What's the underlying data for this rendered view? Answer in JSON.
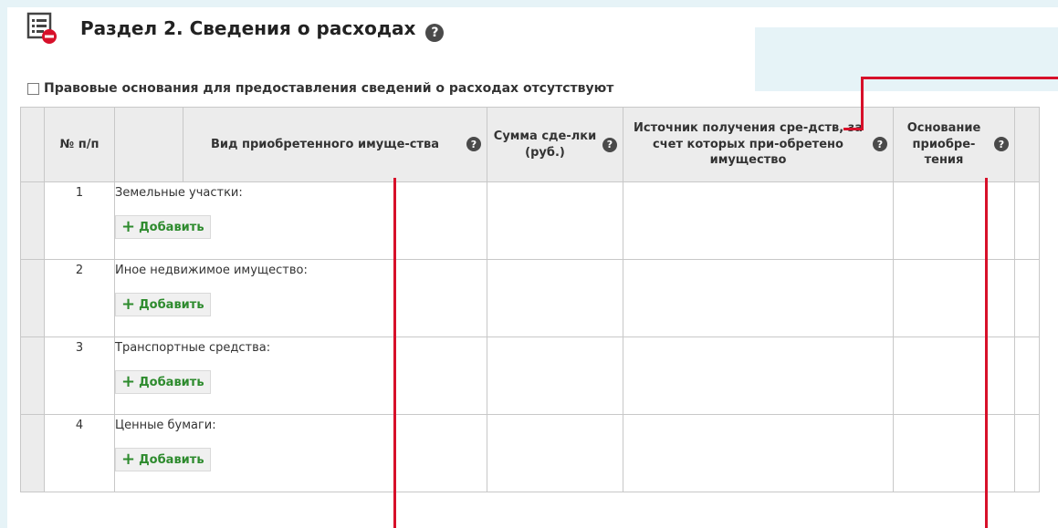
{
  "section": {
    "title": "Раздел 2. Сведения о расходах",
    "help_glyph": "?",
    "icon": "list-remove-icon"
  },
  "checkbox": {
    "label": "Правовые основания для предоставления сведений о расходах отсутствуют",
    "checked": false
  },
  "table": {
    "headers": {
      "num": "№ п/п",
      "type": "Вид приобретенного имуще-ства",
      "amount": "Сумма сде-лки (руб.)",
      "source": "Источник получения сре-дств, за счет которых при-обретено имущество",
      "basis": "Основание приобре-тения"
    },
    "rows": [
      {
        "num": "1",
        "label": "Земельные участки:",
        "add": "Добавить"
      },
      {
        "num": "2",
        "label": "Иное недвижимое имущество:",
        "add": "Добавить"
      },
      {
        "num": "3",
        "label": "Транспортные средства:",
        "add": "Добавить"
      },
      {
        "num": "4",
        "label": "Ценные бумаги:",
        "add": "Добавить"
      }
    ]
  },
  "colors": {
    "accent_red": "#d7102a",
    "add_green": "#2e8b2e",
    "background": "#e6f3f7"
  }
}
